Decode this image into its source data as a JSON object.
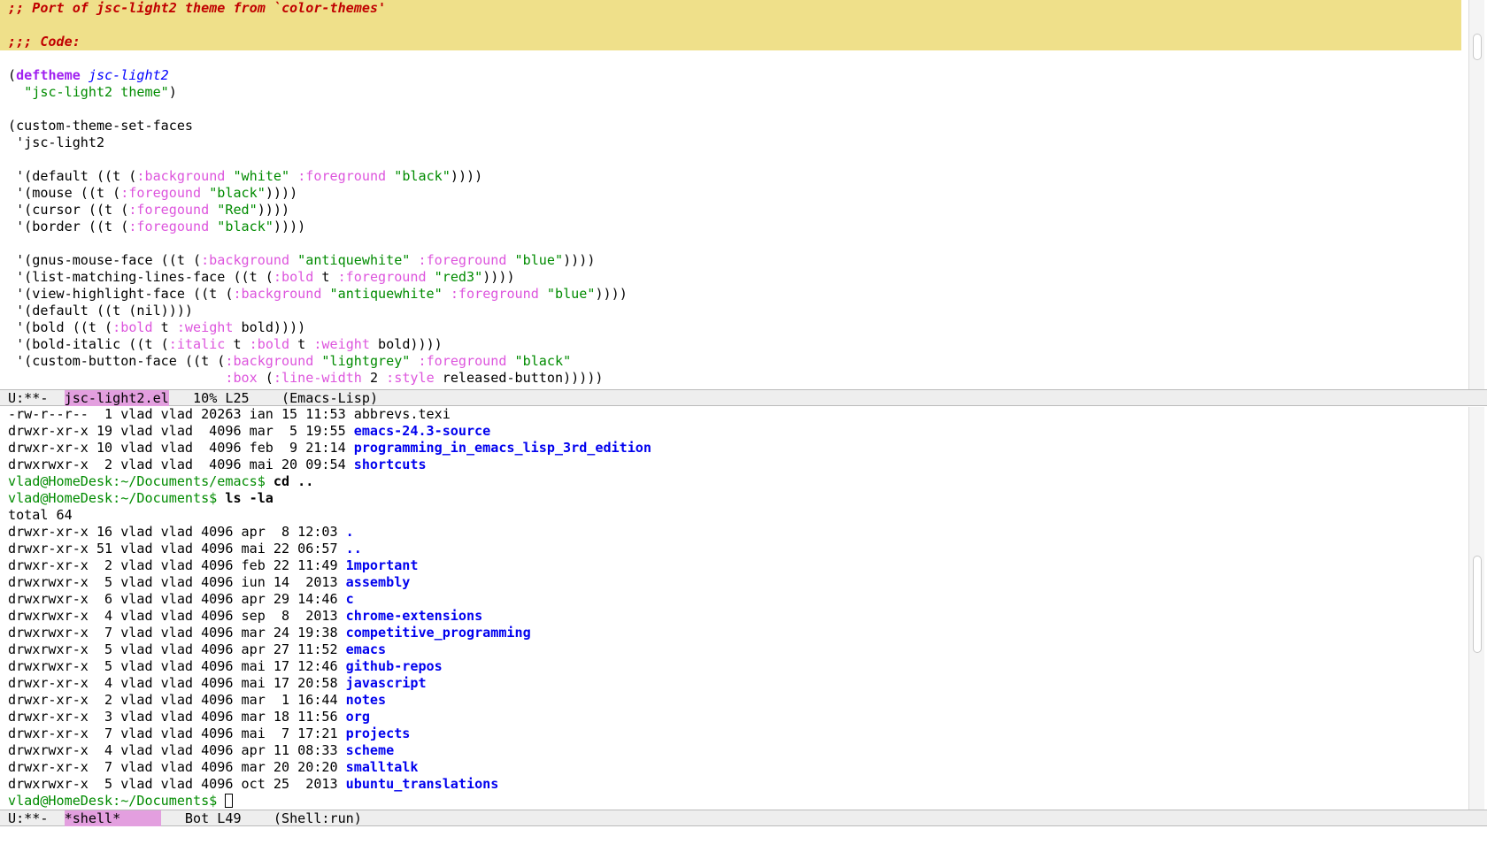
{
  "editor": {
    "top_lines": [
      [
        {
          "t": ";; Port of jsc-light2 theme from `color-themes'",
          "c": "comment"
        }
      ],
      [],
      [
        {
          "t": ";;; Code:",
          "c": "comment"
        }
      ],
      [],
      [
        {
          "t": "(",
          "c": ""
        },
        {
          "t": "deftheme",
          "c": "kw"
        },
        {
          "t": " ",
          "c": ""
        },
        {
          "t": "jsc-light2",
          "c": "fn"
        }
      ],
      [
        {
          "t": "  ",
          "c": ""
        },
        {
          "t": "\"jsc-light2 theme\"",
          "c": "str"
        },
        {
          "t": ")",
          "c": ""
        }
      ],
      [],
      [
        {
          "t": "(custom-theme-set-faces",
          "c": ""
        }
      ],
      [
        {
          "t": " 'jsc-light2",
          "c": ""
        }
      ],
      [],
      [
        {
          "t": " '(default ((t (",
          "c": ""
        },
        {
          "t": ":background",
          "c": "key"
        },
        {
          "t": " ",
          "c": ""
        },
        {
          "t": "\"white\"",
          "c": "str"
        },
        {
          "t": " ",
          "c": ""
        },
        {
          "t": ":foreground",
          "c": "key"
        },
        {
          "t": " ",
          "c": ""
        },
        {
          "t": "\"black\"",
          "c": "str"
        },
        {
          "t": "))))",
          "c": ""
        }
      ],
      [
        {
          "t": " '(mouse ((t (",
          "c": ""
        },
        {
          "t": ":foregound",
          "c": "key"
        },
        {
          "t": " ",
          "c": ""
        },
        {
          "t": "\"black\"",
          "c": "str"
        },
        {
          "t": "))))",
          "c": ""
        }
      ],
      [
        {
          "t": " '(cursor ((t (",
          "c": ""
        },
        {
          "t": ":foregound",
          "c": "key"
        },
        {
          "t": " ",
          "c": ""
        },
        {
          "t": "\"Red\"",
          "c": "str"
        },
        {
          "t": "))))",
          "c": ""
        }
      ],
      [
        {
          "t": " '(border ((t (",
          "c": ""
        },
        {
          "t": ":foregound",
          "c": "key"
        },
        {
          "t": " ",
          "c": ""
        },
        {
          "t": "\"black\"",
          "c": "str"
        },
        {
          "t": "))))",
          "c": ""
        }
      ],
      [],
      [
        {
          "t": " '(gnus-mouse-face ((t (",
          "c": ""
        },
        {
          "t": ":background",
          "c": "key"
        },
        {
          "t": " ",
          "c": ""
        },
        {
          "t": "\"antiquewhite\"",
          "c": "str"
        },
        {
          "t": " ",
          "c": ""
        },
        {
          "t": ":foreground",
          "c": "key"
        },
        {
          "t": " ",
          "c": ""
        },
        {
          "t": "\"blue\"",
          "c": "str"
        },
        {
          "t": "))))",
          "c": ""
        }
      ],
      [
        {
          "t": " '(list-matching-lines-face ((t (",
          "c": ""
        },
        {
          "t": ":bold",
          "c": "key"
        },
        {
          "t": " t ",
          "c": ""
        },
        {
          "t": ":foreground",
          "c": "key"
        },
        {
          "t": " ",
          "c": ""
        },
        {
          "t": "\"red3\"",
          "c": "str"
        },
        {
          "t": "))))",
          "c": ""
        }
      ],
      [
        {
          "t": " '(view-highlight-face ((t (",
          "c": ""
        },
        {
          "t": ":background",
          "c": "key"
        },
        {
          "t": " ",
          "c": ""
        },
        {
          "t": "\"antiquewhite\"",
          "c": "str"
        },
        {
          "t": " ",
          "c": ""
        },
        {
          "t": ":foreground",
          "c": "key"
        },
        {
          "t": " ",
          "c": ""
        },
        {
          "t": "\"blue\"",
          "c": "str"
        },
        {
          "t": "))))",
          "c": ""
        }
      ],
      [
        {
          "t": " '(default ((t (nil))))",
          "c": ""
        }
      ],
      [
        {
          "t": " '(bold ((t (",
          "c": ""
        },
        {
          "t": ":bold",
          "c": "key"
        },
        {
          "t": " t ",
          "c": ""
        },
        {
          "t": ":weight",
          "c": "key"
        },
        {
          "t": " bold))))",
          "c": ""
        }
      ],
      [
        {
          "t": " '(bold-italic ((t (",
          "c": ""
        },
        {
          "t": ":italic",
          "c": "key"
        },
        {
          "t": " t ",
          "c": ""
        },
        {
          "t": ":bold",
          "c": "key"
        },
        {
          "t": " t ",
          "c": ""
        },
        {
          "t": ":weight",
          "c": "key"
        },
        {
          "t": " bold))))",
          "c": ""
        }
      ],
      [
        {
          "t": " '(custom-button-face ((t (",
          "c": ""
        },
        {
          "t": ":background",
          "c": "key"
        },
        {
          "t": " ",
          "c": ""
        },
        {
          "t": "\"lightgrey\"",
          "c": "str"
        },
        {
          "t": " ",
          "c": ""
        },
        {
          "t": ":foreground",
          "c": "key"
        },
        {
          "t": " ",
          "c": ""
        },
        {
          "t": "\"black\"",
          "c": "str"
        }
      ],
      [
        {
          "t": "                           ",
          "c": ""
        },
        {
          "t": ":box",
          "c": "key"
        },
        {
          "t": " (",
          "c": ""
        },
        {
          "t": ":line-width",
          "c": "key"
        },
        {
          "t": " 2 ",
          "c": ""
        },
        {
          "t": ":style",
          "c": "key"
        },
        {
          "t": " released-button)))))",
          "c": ""
        }
      ]
    ],
    "top_modeline": {
      "status": "U:**-  ",
      "buffer": "jsc-light2.el",
      "rest": "   10% L25    (Emacs-Lisp)"
    },
    "shell_lines": [
      [
        {
          "t": "-rw-r--r--  1 vlad vlad 20263 ian 15 11:53 ",
          "c": ""
        },
        {
          "t": "abbrevs.texi",
          "c": ""
        }
      ],
      [
        {
          "t": "drwxr-xr-x 19 vlad vlad  4096 mar  5 19:55 ",
          "c": ""
        },
        {
          "t": "emacs-24.3-source",
          "c": "dir"
        }
      ],
      [
        {
          "t": "drwxr-xr-x 10 vlad vlad  4096 feb  9 21:14 ",
          "c": ""
        },
        {
          "t": "programming_in_emacs_lisp_3rd_edition",
          "c": "dir"
        }
      ],
      [
        {
          "t": "drwxrwxr-x  2 vlad vlad  4096 mai 20 09:54 ",
          "c": ""
        },
        {
          "t": "shortcuts",
          "c": "dir"
        }
      ],
      [
        {
          "t": "vlad@HomeDesk:~/Documents/emacs$ ",
          "c": "prompt"
        },
        {
          "t": "cd ..",
          "c": "bold"
        }
      ],
      [
        {
          "t": "vlad@HomeDesk:~/Documents$ ",
          "c": "prompt"
        },
        {
          "t": "ls -la",
          "c": "bold"
        }
      ],
      [
        {
          "t": "total 64",
          "c": ""
        }
      ],
      [
        {
          "t": "drwxr-xr-x 16 vlad vlad 4096 apr  8 12:03 ",
          "c": ""
        },
        {
          "t": ".",
          "c": "dir"
        }
      ],
      [
        {
          "t": "drwxr-xr-x 51 vlad vlad 4096 mai 22 06:57 ",
          "c": ""
        },
        {
          "t": "..",
          "c": "dir"
        }
      ],
      [
        {
          "t": "drwxr-xr-x  2 vlad vlad 4096 feb 22 11:49 ",
          "c": ""
        },
        {
          "t": "1mportant",
          "c": "dir"
        }
      ],
      [
        {
          "t": "drwxrwxr-x  5 vlad vlad 4096 iun 14  2013 ",
          "c": ""
        },
        {
          "t": "assembly",
          "c": "dir"
        }
      ],
      [
        {
          "t": "drwxrwxr-x  6 vlad vlad 4096 apr 29 14:46 ",
          "c": ""
        },
        {
          "t": "c",
          "c": "dir"
        }
      ],
      [
        {
          "t": "drwxrwxr-x  4 vlad vlad 4096 sep  8  2013 ",
          "c": ""
        },
        {
          "t": "chrome-extensions",
          "c": "dir"
        }
      ],
      [
        {
          "t": "drwxrwxr-x  7 vlad vlad 4096 mar 24 19:38 ",
          "c": ""
        },
        {
          "t": "competitive_programming",
          "c": "dir"
        }
      ],
      [
        {
          "t": "drwxrwxr-x  5 vlad vlad 4096 apr 27 11:52 ",
          "c": ""
        },
        {
          "t": "emacs",
          "c": "dir"
        }
      ],
      [
        {
          "t": "drwxrwxr-x  5 vlad vlad 4096 mai 17 12:46 ",
          "c": ""
        },
        {
          "t": "github-repos",
          "c": "dir"
        }
      ],
      [
        {
          "t": "drwxr-xr-x  4 vlad vlad 4096 mai 17 20:58 ",
          "c": ""
        },
        {
          "t": "javascript",
          "c": "dir"
        }
      ],
      [
        {
          "t": "drwxr-xr-x  2 vlad vlad 4096 mar  1 16:44 ",
          "c": ""
        },
        {
          "t": "notes",
          "c": "dir"
        }
      ],
      [
        {
          "t": "drwxr-xr-x  3 vlad vlad 4096 mar 18 11:56 ",
          "c": ""
        },
        {
          "t": "org",
          "c": "dir"
        }
      ],
      [
        {
          "t": "drwxr-xr-x  7 vlad vlad 4096 mai  7 17:21 ",
          "c": ""
        },
        {
          "t": "projects",
          "c": "dir"
        }
      ],
      [
        {
          "t": "drwxrwxr-x  4 vlad vlad 4096 apr 11 08:33 ",
          "c": ""
        },
        {
          "t": "scheme",
          "c": "dir"
        }
      ],
      [
        {
          "t": "drwxr-xr-x  7 vlad vlad 4096 mar 20 20:20 ",
          "c": ""
        },
        {
          "t": "smalltalk",
          "c": "dir"
        }
      ],
      [
        {
          "t": "drwxrwxr-x  5 vlad vlad 4096 oct 25  2013 ",
          "c": ""
        },
        {
          "t": "ubuntu_translations",
          "c": "dir"
        }
      ]
    ],
    "shell_prompt": "vlad@HomeDesk:~/Documents$ ",
    "bottom_modeline": {
      "status": "U:**-  ",
      "buffer": "*shell*     ",
      "rest": "   Bot L49    (Shell:run)"
    }
  },
  "colors": {
    "comment_bg": "#efe08a",
    "comment_fg": "#c00000",
    "keyword": "#a020f0",
    "function_name": "#0000ff",
    "string": "#008b00",
    "keyword_arg": "#dd55dd",
    "directory": "#0000ee",
    "modeline_bg": "#eeeeee",
    "buffer_name_bg": "#e39fdf"
  }
}
